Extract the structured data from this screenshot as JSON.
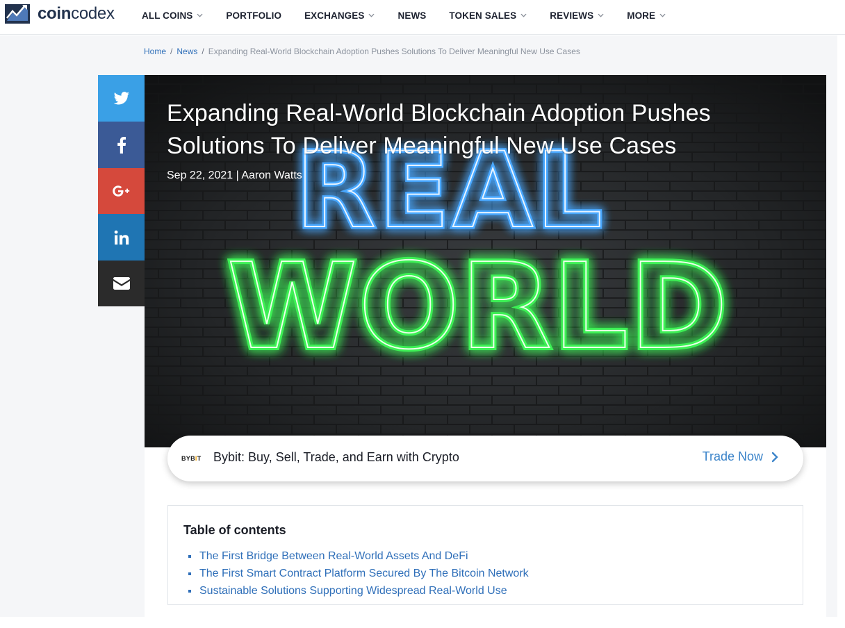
{
  "brand": {
    "name_bold": "coin",
    "name_light": "codex"
  },
  "nav": [
    {
      "label": "ALL COINS",
      "has_dropdown": true
    },
    {
      "label": "PORTFOLIO",
      "has_dropdown": false
    },
    {
      "label": "EXCHANGES",
      "has_dropdown": true
    },
    {
      "label": "NEWS",
      "has_dropdown": false
    },
    {
      "label": "TOKEN SALES",
      "has_dropdown": true
    },
    {
      "label": "REVIEWS",
      "has_dropdown": true
    },
    {
      "label": "MORE",
      "has_dropdown": true
    }
  ],
  "breadcrumb": {
    "home": "Home",
    "news": "News",
    "current": "Expanding Real-World Blockchain Adoption Pushes Solutions To Deliver Meaningful New Use Cases",
    "separator": "/"
  },
  "article": {
    "title": "Expanding Real-World Blockchain Adoption Pushes Solutions To Deliver Meaningful New Use Cases",
    "meta": "Sep 22, 2021 | Aaron Watts",
    "hero_words": {
      "top": "REAL",
      "bottom": "WORLD"
    }
  },
  "share": [
    {
      "name": "twitter",
      "icon": "twitter-icon",
      "color": "#3aa0e6"
    },
    {
      "name": "facebook",
      "icon": "facebook-icon",
      "color": "#3b5a96"
    },
    {
      "name": "google-plus",
      "icon": "google-plus-icon",
      "color": "#d5493c"
    },
    {
      "name": "linkedin",
      "icon": "linkedin-icon",
      "color": "#1f75b3"
    },
    {
      "name": "email",
      "icon": "envelope-icon",
      "color": "#2b2b2b"
    }
  ],
  "promo": {
    "logo_text": "BYB",
    "logo_accent": "I",
    "logo_text_end": "T",
    "text": "Bybit: Buy, Sell, Trade, and Earn with Crypto",
    "cta": "Trade Now"
  },
  "toc": {
    "title": "Table of contents",
    "items": [
      "The First Bridge Between Real-World Assets And DeFi",
      "The First Smart Contract Platform Secured By The Bitcoin Network",
      "Sustainable Solutions Supporting Widespread Real-World Use"
    ]
  },
  "colors": {
    "link": "#2f6fb9",
    "brand": "#22324d",
    "neon_blue": "#4aa8ff",
    "neon_green": "#5cff6a"
  }
}
